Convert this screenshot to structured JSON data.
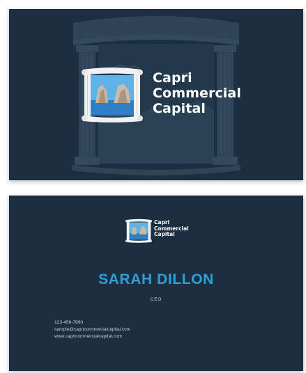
{
  "brand": {
    "line1": "Capri",
    "line2": "Commercial",
    "line3": "Capital"
  },
  "person": {
    "name": "SARAH DILLON",
    "title": "CEO"
  },
  "contact": {
    "phone": "123-456-7890",
    "email": "sample@capricommercialcapital.com",
    "website": "www.capricommercialcapital.com"
  },
  "colors": {
    "card_background": "#1c2f40",
    "name_accent": "#2e9fd8",
    "logo_text": "#ffffff",
    "frame_white": "#f2f2f2",
    "sea_blue": "#2f7fc4"
  },
  "icons": {
    "logo_mark": "framed-faraglioni-rocks-icon",
    "background_art": "ionic-columns-arch"
  }
}
